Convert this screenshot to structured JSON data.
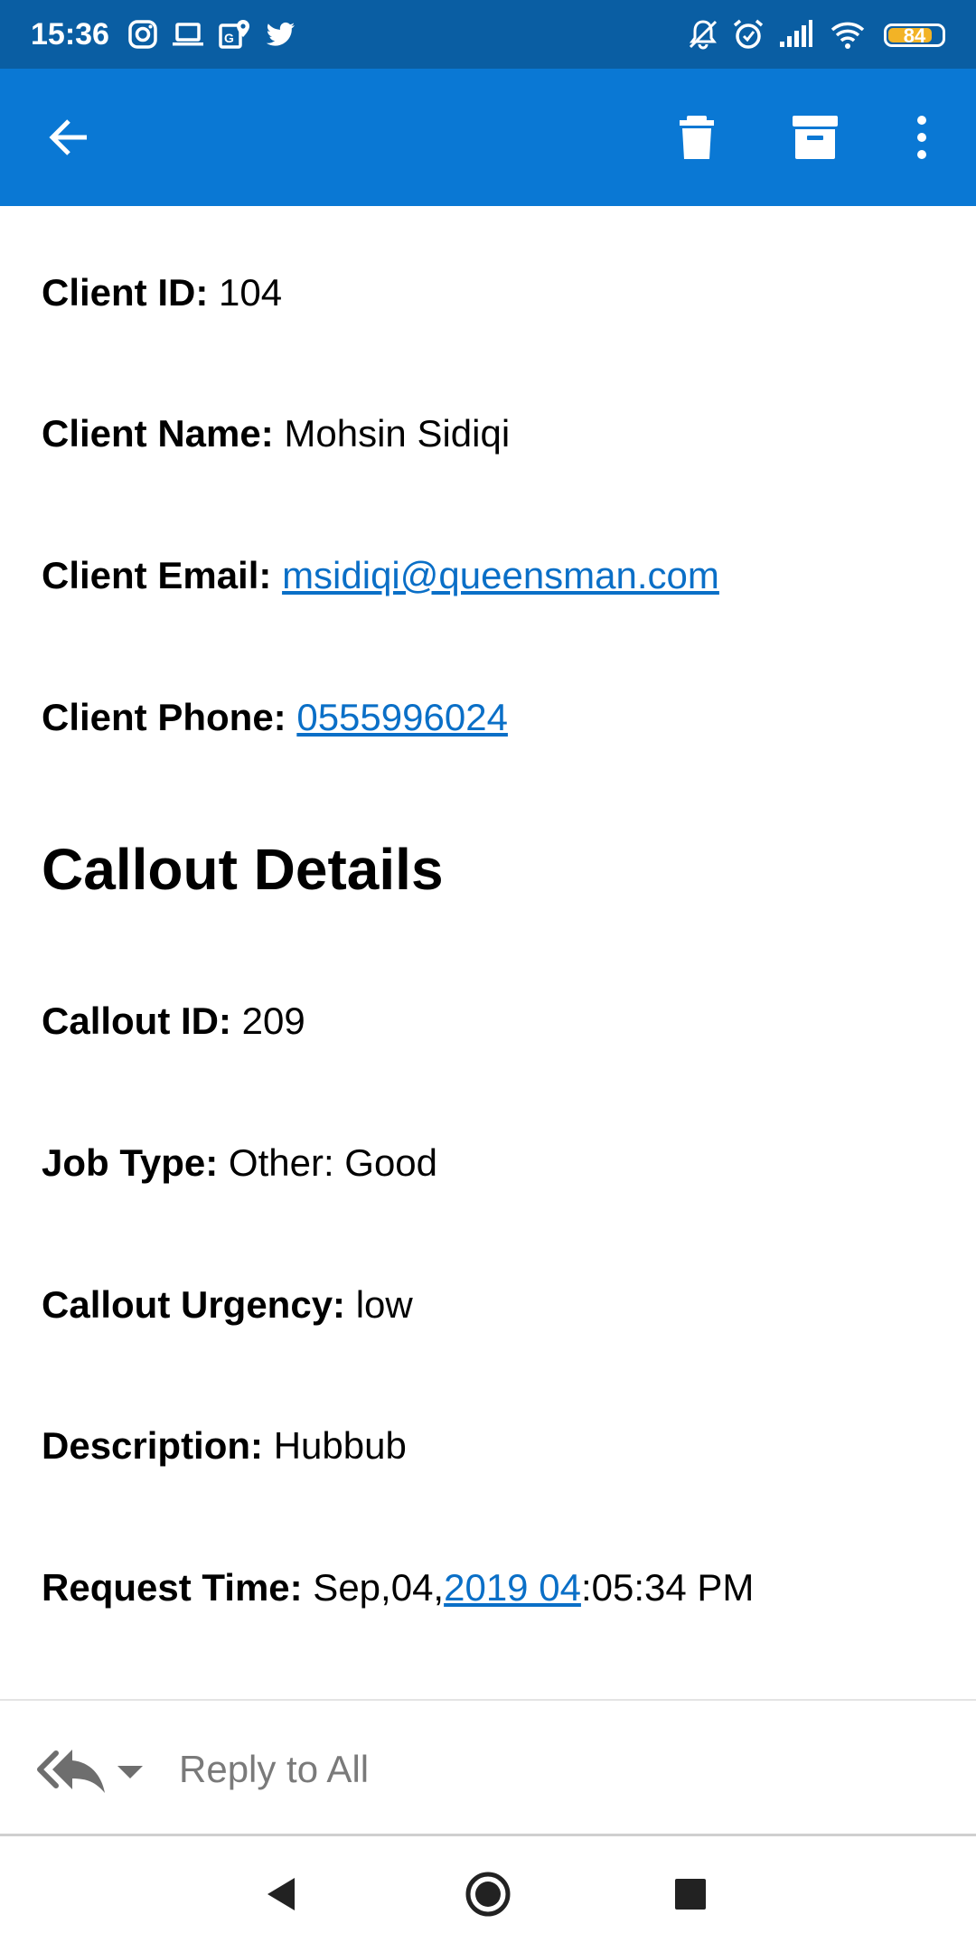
{
  "status_bar": {
    "time": "15:36",
    "left_icons": [
      "instagram-icon",
      "laptop-icon",
      "maps-icon",
      "twitter-icon"
    ],
    "right_icons": [
      "bell-muted-icon",
      "alarm-icon",
      "signal-icon",
      "wifi-icon"
    ],
    "battery": "84"
  },
  "toolbar": {
    "icons": [
      "back-arrow-icon",
      "delete-icon",
      "archive-icon",
      "more-vertical-icon"
    ]
  },
  "client": {
    "id_label": "Client ID:",
    "id_value": " 104",
    "name_label": "Client Name:",
    "name_value": " Mohsin Sidiqi",
    "email_label": "Client Email:",
    "email_value": "msidiqi@queensman.com",
    "phone_label": "Client Phone:",
    "phone_value": "0555996024"
  },
  "callout": {
    "section_title": "Callout Details",
    "id_label": "Callout ID:",
    "id_value": " 209",
    "job_type_label": "Job Type:",
    "job_type_value": " Other: Good",
    "urgency_label": "Callout Urgency:",
    "urgency_value": " low",
    "description_label": "Description:",
    "description_value": " Hubbub",
    "request_time_label": "Request Time:",
    "request_time_prefix": " Sep,04,",
    "request_time_link": "2019 04",
    "request_time_suffix": ":05:34 PM"
  },
  "reply_bar": {
    "label": "Reply to All"
  },
  "colors": {
    "status_bar": "#0a5ea3",
    "app_bar": "#0a78d4",
    "link": "#0a6fc7",
    "battery": "#f2b326"
  }
}
